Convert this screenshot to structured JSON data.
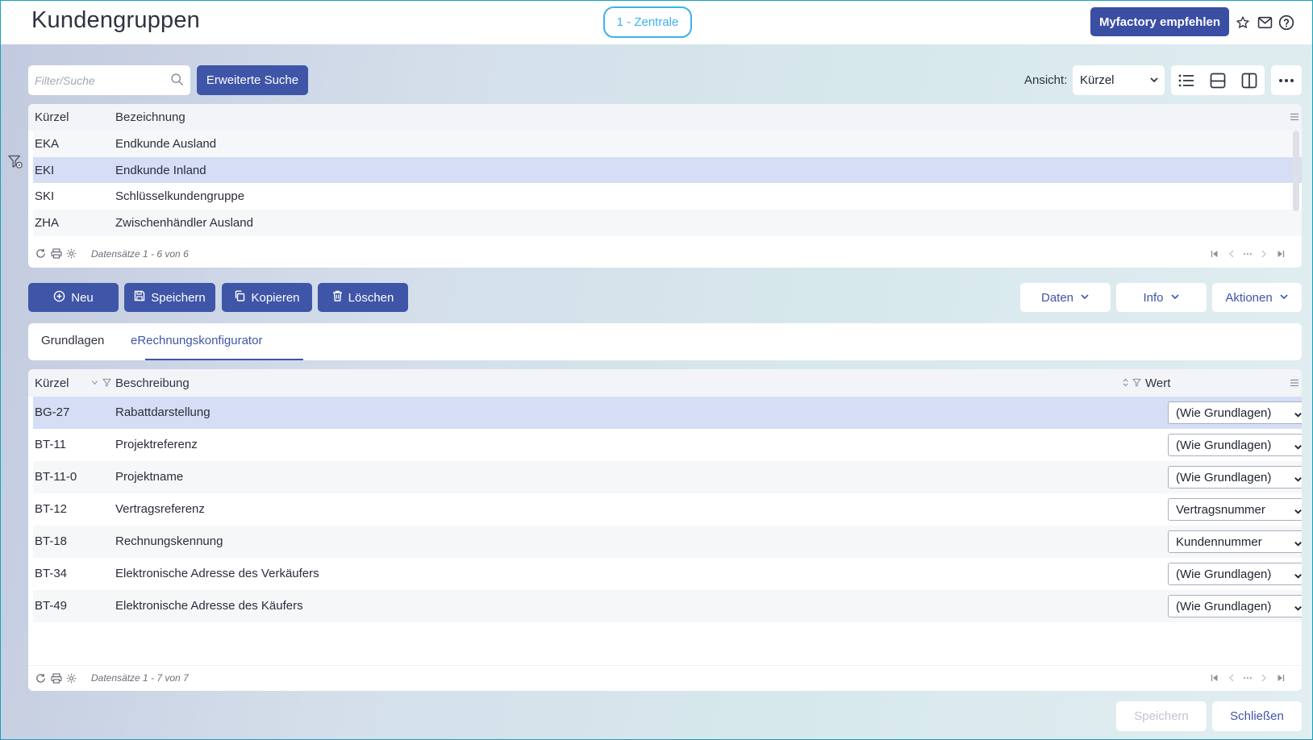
{
  "header": {
    "title": "Kundengruppen",
    "organization": "1 - Zentrale",
    "recommend_label": "Myfactory empfehlen",
    "icons": [
      "star-icon",
      "mail-icon",
      "help-icon"
    ]
  },
  "search": {
    "placeholder": "Filter/Suche",
    "value": "",
    "advanced_label": "Erweiterte Suche"
  },
  "view": {
    "label": "Ansicht:",
    "selected": "Kürzel",
    "options": [
      "Kürzel"
    ]
  },
  "groups_grid": {
    "columns": [
      "Kürzel",
      "Bezeichnung"
    ],
    "rows": [
      {
        "code": "EKA",
        "name": "Endkunde Ausland",
        "selected": false
      },
      {
        "code": "EKI",
        "name": "Endkunde Inland",
        "selected": true
      },
      {
        "code": "SKI",
        "name": "Schlüsselkundengruppe",
        "selected": false
      },
      {
        "code": "ZHA",
        "name": "Zwischenhändler Ausland",
        "selected": false
      }
    ],
    "records_text": "Datensätze 1 - 6 von 6"
  },
  "toolbar": {
    "new_label": "Neu",
    "save_label": "Speichern",
    "copy_label": "Kopieren",
    "delete_label": "Löschen",
    "data_label": "Daten",
    "info_label": "Info",
    "actions_label": "Aktionen"
  },
  "tabs": [
    {
      "label": "Grundlagen",
      "active": false
    },
    {
      "label": "eRechnungskonfigurator",
      "active": true
    }
  ],
  "config_grid": {
    "columns": [
      "Kürzel",
      "Beschreibung",
      "Wert"
    ],
    "rows": [
      {
        "code": "BG-27",
        "description": "Rabattdarstellung",
        "value": "(Wie Grundlagen)",
        "selected": true
      },
      {
        "code": "BT-11",
        "description": "Projektreferenz",
        "value": "(Wie Grundlagen)",
        "selected": false
      },
      {
        "code": "BT-11-0",
        "description": "Projektname",
        "value": "(Wie Grundlagen)",
        "selected": false
      },
      {
        "code": "BT-12",
        "description": "Vertragsreferenz",
        "value": "Vertragsnummer",
        "selected": false
      },
      {
        "code": "BT-18",
        "description": "Rechnungskennung",
        "value": "Kundennummer",
        "selected": false
      },
      {
        "code": "BT-34",
        "description": "Elektronische Adresse des Verkäufers",
        "value": "(Wie Grundlagen)",
        "selected": false
      },
      {
        "code": "BT-49",
        "description": "Elektronische Adresse des Käufers",
        "value": "(Wie Grundlagen)",
        "selected": false
      }
    ],
    "records_text": "Datensätze 1 - 7 von 7"
  },
  "footer": {
    "save_label": "Speichern",
    "close_label": "Schließen"
  },
  "colors": {
    "accent": "#3f55a7",
    "selection": "#d6def6",
    "org_pill": "#3bb3e6"
  }
}
